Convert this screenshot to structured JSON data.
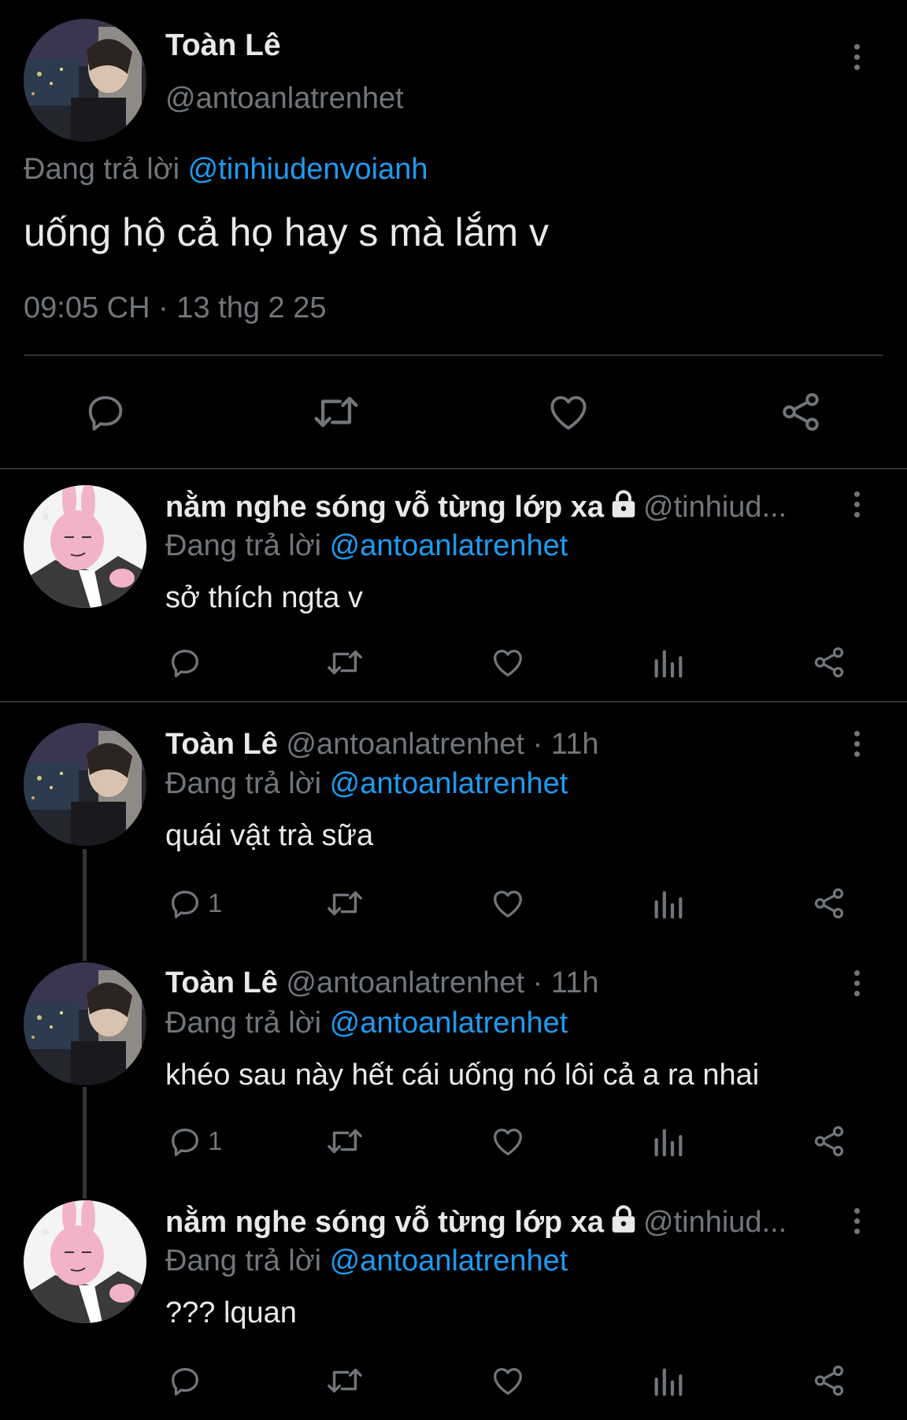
{
  "main_tweet": {
    "display_name": "Toàn Lê",
    "handle": "@antoanlatrenhet",
    "replying_prefix": "Đang trả lời",
    "replying_to": "@tinhiudenvoianh",
    "text": "uống hộ cả họ hay s mà lắm v",
    "timestamp": "09:05 CH · 13 thg 2 25",
    "actions": [
      "reply-icon",
      "retweet-icon",
      "like-icon",
      "share-icon"
    ]
  },
  "replies": [
    {
      "display_name": "nằm nghe sóng vỗ từng lớp xa",
      "protected": true,
      "handle": "@tinhiud...",
      "time": "",
      "replying_prefix": "Đang trả lời",
      "replying_to": "@antoanlatrenhet",
      "text": "sở thích ngta v",
      "reply_count": ""
    },
    {
      "display_name": "Toàn Lê",
      "protected": false,
      "handle": "@antoanlatrenhet",
      "time": "· 11h",
      "replying_prefix": "Đang trả lời",
      "replying_to": "@antoanlatrenhet",
      "text": "quái vật trà sữa",
      "reply_count": "1"
    },
    {
      "display_name": "Toàn Lê",
      "protected": false,
      "handle": "@antoanlatrenhet",
      "time": "· 11h",
      "replying_prefix": "Đang trả lời",
      "replying_to": "@antoanlatrenhet",
      "text": "khéo sau này hết cái uống nó lôi cả a ra nhai",
      "reply_count": "1"
    },
    {
      "display_name": "nằm nghe sóng vỗ từng lớp xa",
      "protected": true,
      "handle": "@tinhiud...",
      "time": "",
      "replying_prefix": "Đang trả lời",
      "replying_to": "@antoanlatrenhet",
      "text": "??? lquan",
      "reply_count": ""
    }
  ],
  "colors": {
    "background": "#000000",
    "text": "#e7e9ea",
    "muted": "#71767b",
    "link": "#1d9bf0",
    "divider": "#2f3336"
  }
}
